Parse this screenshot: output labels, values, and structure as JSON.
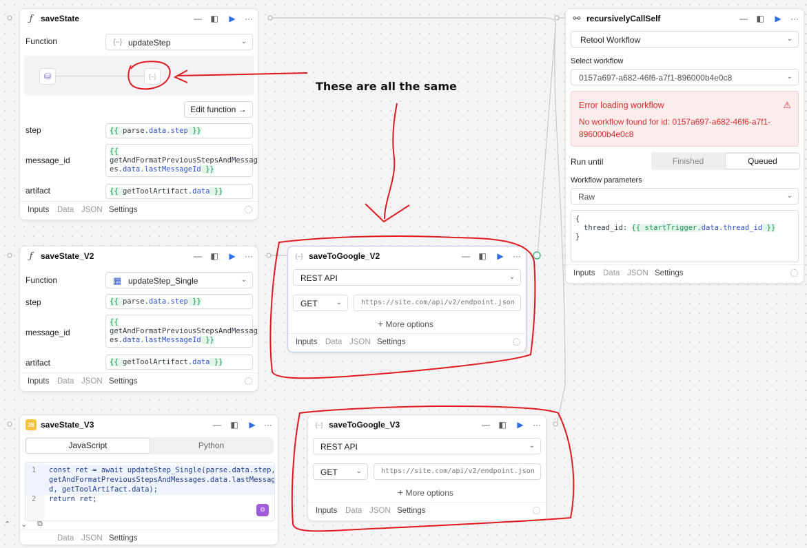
{
  "annotation": {
    "text": "These are all the same"
  },
  "colors": {
    "accent": "#2f6ee6",
    "error_bg": "#fdecec",
    "error_text": "#d82c2c",
    "annotation_red": "#e0191d"
  },
  "common": {
    "tabs": [
      "Inputs",
      "Data",
      "JSON",
      "Settings"
    ],
    "rest_api": "REST API",
    "method": "GET",
    "url_placeholder": "https://site.com/api/v2/endpoint.json",
    "more_options": "More options"
  },
  "saveState": {
    "title": "saveState",
    "function_label": "Function",
    "function_value": "updateStep",
    "edit_function": "Edit function",
    "params": [
      {
        "label": "step",
        "pre": "{{ ",
        "a": "parse.",
        "b": "data.step",
        "post": " }}"
      },
      {
        "label": "message_id",
        "line1": "{{",
        "line2": "getAndFormatPreviousStepsAndMessag",
        "line3a": "es.",
        "line3b": "data.lastMessageId",
        "line3c": " }}"
      },
      {
        "label": "artifact",
        "pre": "{{ ",
        "a": "getToolArtifact.",
        "b": "data",
        "post": " }}"
      }
    ]
  },
  "saveState_V2": {
    "title": "saveState_V2",
    "function_label": "Function",
    "function_value": "updateStep_Single",
    "params": [
      {
        "label": "step",
        "pre": "{{ ",
        "a": "parse.",
        "b": "data.step",
        "post": " }}"
      },
      {
        "label": "message_id",
        "line1": "{{",
        "line2": "getAndFormatPreviousStepsAndMessag",
        "line3a": "es.",
        "line3b": "data.lastMessageId",
        "line3c": " }}"
      },
      {
        "label": "artifact",
        "pre": "{{ ",
        "a": "getToolArtifact.",
        "b": "data",
        "post": " }}"
      }
    ]
  },
  "saveState_V3": {
    "title": "saveState_V3",
    "lang_tabs": [
      "JavaScript",
      "Python"
    ],
    "code_lines": [
      {
        "num": "1",
        "text": "const ret = await updateStep_Single(parse.data.step,"
      },
      {
        "num": "",
        "text": "getAndFormatPreviousStepsAndMessages.data.lastMessageI"
      },
      {
        "num": "",
        "text": "d, getToolArtifact.data);"
      },
      {
        "num": "2",
        "text": "return ret;"
      }
    ]
  },
  "saveToGoogle_V2": {
    "title": "saveToGoogle_V2"
  },
  "saveToGoogle_V3": {
    "title": "saveToGoogle_V3"
  },
  "recursivelyCallSelf": {
    "title": "recursivelyCallSelf",
    "type_value": "Retool Workflow",
    "select_workflow_label": "Select workflow",
    "workflow_id": "0157a697-a682-46f6-a7f1-896000b4e0c8",
    "error_title": "Error loading workflow",
    "error_line1": "No workflow found for id: 0157a697-a682-46f6-a7f1-",
    "error_line2": "896000b4e0c8",
    "run_until_label": "Run until",
    "run_until_options": [
      "Finished",
      "Queued"
    ],
    "workflow_params_label": "Workflow parameters",
    "params_format": "Raw",
    "json_open": "{",
    "json_key": "thread_id: ",
    "json_val_a": "{{ startTrigger.",
    "json_val_b": "data.thread_id",
    "json_val_c": " }}",
    "json_close": "}"
  }
}
